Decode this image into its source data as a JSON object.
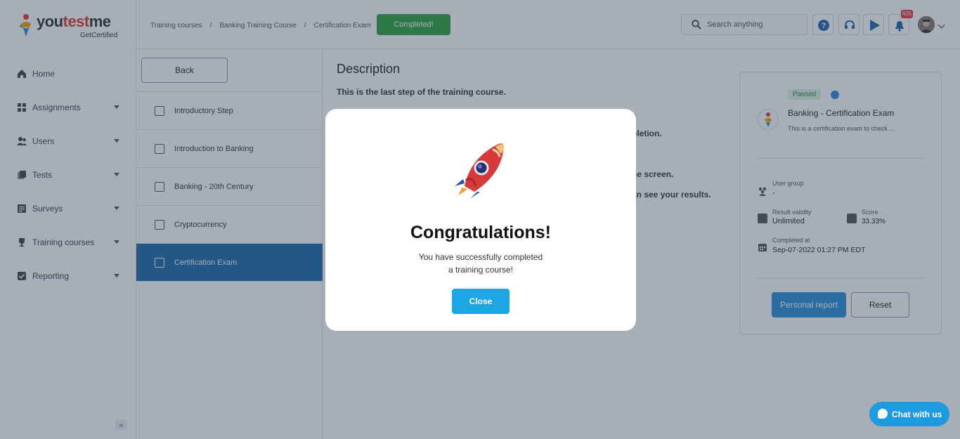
{
  "brand": {
    "name_a": "you",
    "name_b": "test",
    "name_c": "me",
    "sub": "GetCertified"
  },
  "sidebar": {
    "items": [
      {
        "label": "Home",
        "icon": "home-icon",
        "expandable": false
      },
      {
        "label": "Assignments",
        "icon": "assignments-icon",
        "expandable": true
      },
      {
        "label": "Users",
        "icon": "users-icon",
        "expandable": true
      },
      {
        "label": "Tests",
        "icon": "tests-icon",
        "expandable": true
      },
      {
        "label": "Surveys",
        "icon": "surveys-icon",
        "expandable": true
      },
      {
        "label": "Training courses",
        "icon": "trophy-icon",
        "expandable": true
      },
      {
        "label": "Reporting",
        "icon": "reporting-icon",
        "expandable": true
      }
    ],
    "collapse_glyph": "«"
  },
  "header": {
    "breadcrumbs": [
      "Training courses",
      "Banking Training Course",
      "Certification Exam"
    ],
    "crumb_sep": "/",
    "status_label": "Completed!",
    "search_placeholder": "Search anything",
    "notification_count": "635"
  },
  "steps": {
    "back_label": "Back",
    "items": [
      {
        "label": "Introductory Step",
        "active": false
      },
      {
        "label": "Introduction to Banking",
        "active": false
      },
      {
        "label": "Banking - 20th Century",
        "active": false
      },
      {
        "label": "Cryptocurrency",
        "active": false
      },
      {
        "label": "Certification Exam",
        "active": true
      }
    ]
  },
  "content": {
    "title": "Description",
    "lines": [
      "This is the last step of the training course.",
      "pletion.",
      "he screen.",
      "an see your results."
    ]
  },
  "card": {
    "status": "Passed",
    "exam_title": "Banking - Certification Exam",
    "exam_desc": "This is a certification exam to check ...",
    "user_group_label": "User group",
    "user_group_value": "-",
    "validity_label": "Result validity",
    "validity_value": "Unlimited",
    "score_label": "Score",
    "score_value": "33.33%",
    "completed_label": "Completed at",
    "completed_value": "Sep-07-2022 01:27 PM EDT",
    "personal_report_label": "Personal report",
    "reset_label": "Reset"
  },
  "modal": {
    "title": "Congratulations!",
    "message_line1": "You have successfully completed",
    "message_line2": "a training course!",
    "close_label": "Close"
  },
  "chat": {
    "label": "Chat with us"
  },
  "colors": {
    "primary": "#2b8fd8",
    "success": "#2fa43f",
    "active_step": "#1e6aa8",
    "close_button": "#1ea5e3",
    "badge": "#e53935"
  }
}
